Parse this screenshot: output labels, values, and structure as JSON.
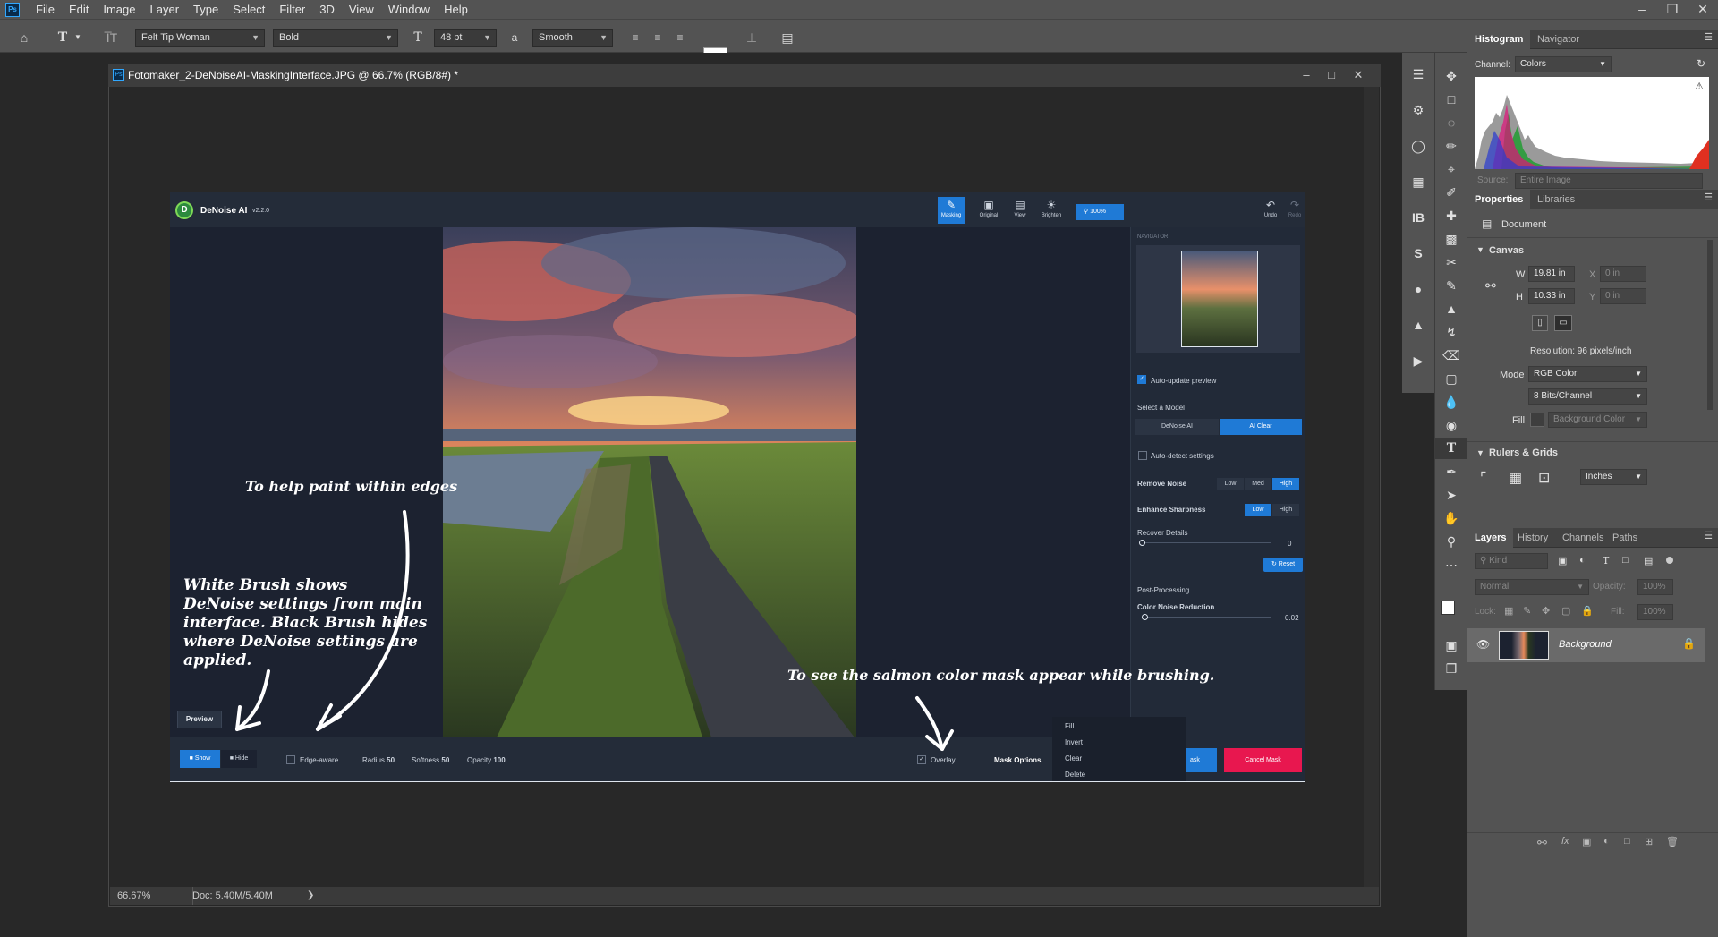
{
  "menubar": {
    "app_logo": "Ps",
    "items": [
      "File",
      "Edit",
      "Image",
      "Layer",
      "Type",
      "Select",
      "Filter",
      "3D",
      "View",
      "Window",
      "Help"
    ]
  },
  "options": {
    "font_family": "Felt Tip Woman",
    "font_style": "Bold",
    "font_size": "48 pt",
    "aa_glyph": "a",
    "antialias": "Smooth"
  },
  "document": {
    "title": "Fotomaker_2-DeNoiseAI-MaskingInterface.JPG @ 66.7% (RGB/8#) *",
    "zoom": "66.67%",
    "doc_size": "Doc: 5.40M/5.40M"
  },
  "denoise": {
    "app_name": "DeNoise AI",
    "version": "v2.2.0",
    "toolbar": {
      "masking": "Masking",
      "original": "Original",
      "view": "View",
      "brighten": "Brighten",
      "zoom": "100%",
      "undo": "Undo",
      "redo": "Redo"
    },
    "navigator_label": "NAVIGATOR",
    "auto_update": "Auto-update preview",
    "select_model": "Select a Model",
    "models": [
      "DeNoise AI",
      "AI Clear"
    ],
    "auto_detect": "Auto-detect settings",
    "remove_noise": "Remove Noise",
    "noise_levels": [
      "Low",
      "Med",
      "High"
    ],
    "enhance_sharpness": "Enhance Sharpness",
    "sharp_levels": [
      "Low",
      "High"
    ],
    "recover_details": "Recover Details",
    "recover_value": "0",
    "reset": "Reset",
    "post_processing": "Post-Processing",
    "color_noise": "Color Noise Reduction",
    "color_noise_value": "0.02",
    "preview": "Preview",
    "show": "Show",
    "hide": "Hide",
    "edge_aware": "Edge-aware",
    "radius_label": "Radius",
    "radius": "50",
    "softness_label": "Softness",
    "softness": "50",
    "opacity_label": "Opacity",
    "opacity": "100",
    "overlay": "Overlay",
    "mask_options": "Mask Options",
    "mask_menu": [
      "Fill",
      "Invert",
      "Clear",
      "Delete"
    ],
    "apply_partial": "ask",
    "cancel_mask": "Cancel Mask"
  },
  "annotations": {
    "paint_edges": "To help paint within edges",
    "white_brush": [
      "White Brush shows",
      "DeNoise settings from main",
      "interface. Black Brush hides",
      "where DeNoise settings are",
      "applied."
    ],
    "salmon": "To see the salmon color mask appear while brushing."
  },
  "histogram": {
    "tabs": [
      "Histogram",
      "Navigator"
    ],
    "channel_label": "Channel:",
    "channel": "Colors",
    "source_label": "Source:",
    "source": "Entire Image"
  },
  "properties": {
    "tabs": [
      "Properties",
      "Libraries"
    ],
    "doc_label": "Document",
    "canvas": "Canvas",
    "w_label": "W",
    "w": "19.81 in",
    "h_label": "H",
    "h": "10.33 in",
    "x_label": "X",
    "x": "0 in",
    "y_label": "Y",
    "y": "0 in",
    "resolution": "Resolution: 96 pixels/inch",
    "mode_label": "Mode",
    "mode": "RGB Color",
    "bits": "8 Bits/Channel",
    "fill_label": "Fill",
    "fill": "Background Color",
    "rulers": "Rulers & Grids",
    "units": "Inches"
  },
  "layers": {
    "tabs": [
      "Layers",
      "History",
      "Channels",
      "Paths"
    ],
    "kind": "Kind",
    "blend": "Normal",
    "opacity_label": "Opacity:",
    "opacity": "100%",
    "lock_label": "Lock:",
    "fill_label": "Fill:",
    "fill": "100%",
    "layer_name": "Background"
  },
  "colors": {
    "accent": "#31a8ff",
    "dn_blue": "#1f7ad6",
    "dn_red": "#e8174f"
  }
}
